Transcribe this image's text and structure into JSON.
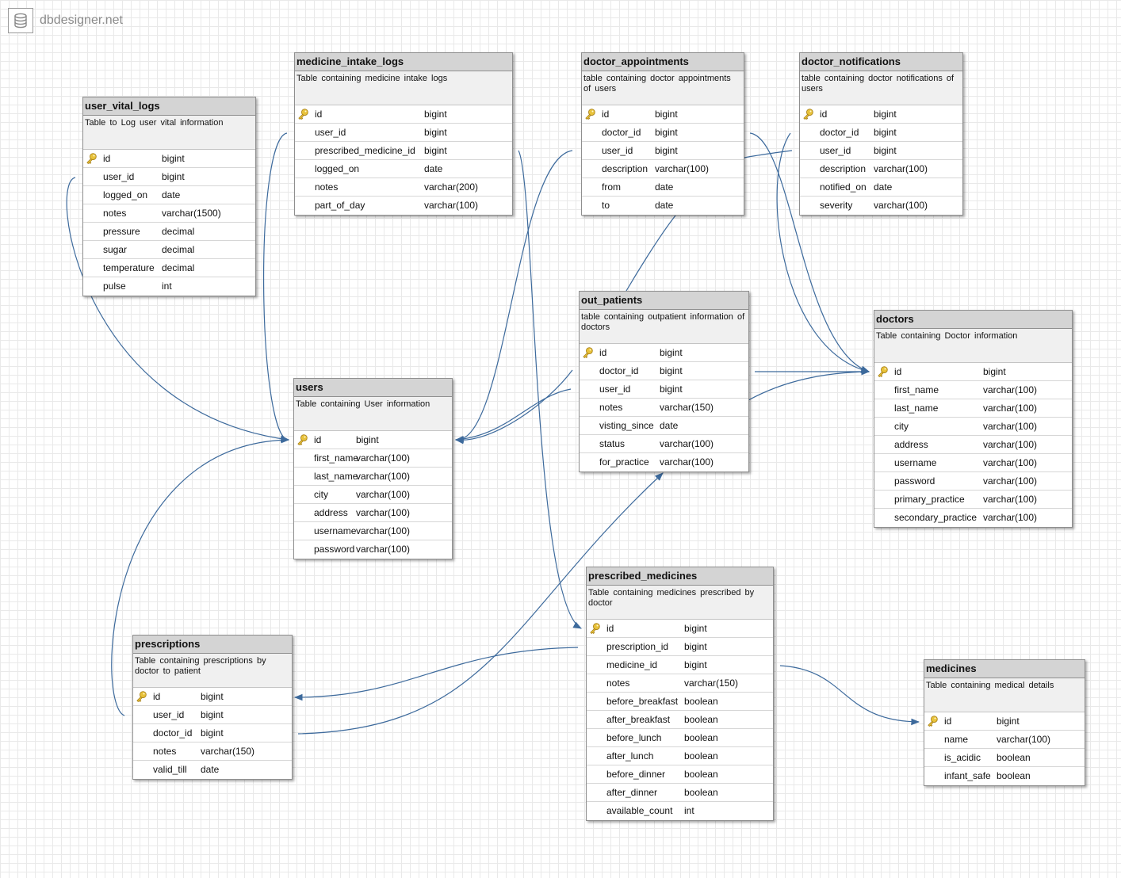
{
  "app": {
    "logo_text": "dbdesigner.net",
    "logo_icon": "database-icon"
  },
  "colors": {
    "connector": "#3d6a9c",
    "header_bg": "#d4d4d4",
    "desc_bg": "#f0f0f0",
    "key_icon": "#e8c23a"
  },
  "tables": [
    {
      "id": "user_vital_logs",
      "name": "user_vital_logs",
      "description": "Table to Log user vital information",
      "columns": [
        {
          "name": "id",
          "type": "bigint",
          "pk": true
        },
        {
          "name": "user_id",
          "type": "bigint"
        },
        {
          "name": "logged_on",
          "type": "date"
        },
        {
          "name": "notes",
          "type": "varchar(1500)"
        },
        {
          "name": "pressure",
          "type": "decimal"
        },
        {
          "name": "sugar",
          "type": "decimal"
        },
        {
          "name": "temperature",
          "type": "decimal"
        },
        {
          "name": "pulse",
          "type": "int"
        }
      ]
    },
    {
      "id": "medicine_intake_logs",
      "name": "medicine_intake_logs",
      "description": "Table containing medicine intake logs",
      "columns": [
        {
          "name": "id",
          "type": "bigint",
          "pk": true
        },
        {
          "name": "user_id",
          "type": "bigint"
        },
        {
          "name": "prescribed_medicine_id",
          "type": "bigint"
        },
        {
          "name": "logged_on",
          "type": "date"
        },
        {
          "name": "notes",
          "type": "varchar(200)"
        },
        {
          "name": "part_of_day",
          "type": "varchar(100)"
        }
      ]
    },
    {
      "id": "doctor_appointments",
      "name": "doctor_appointments",
      "description": "table containing doctor appointments of users",
      "columns": [
        {
          "name": "id",
          "type": "bigint",
          "pk": true
        },
        {
          "name": "doctor_id",
          "type": "bigint"
        },
        {
          "name": "user_id",
          "type": "bigint"
        },
        {
          "name": "description",
          "type": "varchar(100)"
        },
        {
          "name": "from",
          "type": "date"
        },
        {
          "name": "to",
          "type": "date"
        }
      ]
    },
    {
      "id": "doctor_notifications",
      "name": "doctor_notifications",
      "description": "table containing doctor notifications of users",
      "columns": [
        {
          "name": "id",
          "type": "bigint",
          "pk": true
        },
        {
          "name": "doctor_id",
          "type": "bigint"
        },
        {
          "name": "user_id",
          "type": "bigint"
        },
        {
          "name": "description",
          "type": "varchar(100)"
        },
        {
          "name": "notified_on",
          "type": "date"
        },
        {
          "name": "severity",
          "type": "varchar(100)"
        }
      ]
    },
    {
      "id": "out_patients",
      "name": "out_patients",
      "description": "table containing outpatient information of doctors",
      "columns": [
        {
          "name": "id",
          "type": "bigint",
          "pk": true
        },
        {
          "name": "doctor_id",
          "type": "bigint"
        },
        {
          "name": "user_id",
          "type": "bigint"
        },
        {
          "name": "notes",
          "type": "varchar(150)"
        },
        {
          "name": "visting_since",
          "type": "date"
        },
        {
          "name": "status",
          "type": "varchar(100)"
        },
        {
          "name": "for_practice",
          "type": "varchar(100)"
        }
      ]
    },
    {
      "id": "users",
      "name": "users",
      "description": "Table containing User information",
      "columns": [
        {
          "name": "id",
          "type": "bigint",
          "pk": true
        },
        {
          "name": "first_name",
          "type": "varchar(100)"
        },
        {
          "name": "last_name",
          "type": "varchar(100)"
        },
        {
          "name": "city",
          "type": "varchar(100)"
        },
        {
          "name": "address",
          "type": "varchar(100)"
        },
        {
          "name": "username",
          "type": "varchar(100)"
        },
        {
          "name": "password",
          "type": "varchar(100)"
        }
      ]
    },
    {
      "id": "doctors",
      "name": "doctors",
      "description": "Table containing Doctor information",
      "columns": [
        {
          "name": "id",
          "type": "bigint",
          "pk": true
        },
        {
          "name": "first_name",
          "type": "varchar(100)"
        },
        {
          "name": "last_name",
          "type": "varchar(100)"
        },
        {
          "name": "city",
          "type": "varchar(100)"
        },
        {
          "name": "address",
          "type": "varchar(100)"
        },
        {
          "name": "username",
          "type": "varchar(100)"
        },
        {
          "name": "password",
          "type": "varchar(100)"
        },
        {
          "name": "primary_practice",
          "type": "varchar(100)"
        },
        {
          "name": "secondary_practice",
          "type": "varchar(100)"
        }
      ]
    },
    {
      "id": "prescribed_medicines",
      "name": "prescribed_medicines",
      "description": "Table containing medicines prescribed by doctor",
      "columns": [
        {
          "name": "id",
          "type": "bigint",
          "pk": true
        },
        {
          "name": "prescription_id",
          "type": "bigint"
        },
        {
          "name": "medicine_id",
          "type": "bigint"
        },
        {
          "name": "notes",
          "type": "varchar(150)"
        },
        {
          "name": "before_breakfast",
          "type": "boolean"
        },
        {
          "name": "after_breakfast",
          "type": "boolean"
        },
        {
          "name": "before_lunch",
          "type": "boolean"
        },
        {
          "name": "after_lunch",
          "type": "boolean"
        },
        {
          "name": "before_dinner",
          "type": "boolean"
        },
        {
          "name": "after_dinner",
          "type": "boolean"
        },
        {
          "name": "available_count",
          "type": "int"
        }
      ]
    },
    {
      "id": "prescriptions",
      "name": "prescriptions",
      "description": "Table containing prescriptions by doctor to patient",
      "columns": [
        {
          "name": "id",
          "type": "bigint",
          "pk": true
        },
        {
          "name": "user_id",
          "type": "bigint"
        },
        {
          "name": "doctor_id",
          "type": "bigint"
        },
        {
          "name": "notes",
          "type": "varchar(150)"
        },
        {
          "name": "valid_till",
          "type": "date"
        }
      ]
    },
    {
      "id": "medicines",
      "name": "medicines",
      "description": "Table containing medical details",
      "columns": [
        {
          "name": "id",
          "type": "bigint",
          "pk": true
        },
        {
          "name": "name",
          "type": "varchar(100)"
        },
        {
          "name": "is_acidic",
          "type": "boolean"
        },
        {
          "name": "infant_safe",
          "type": "boolean"
        }
      ]
    }
  ],
  "relations": [
    {
      "from": "user_vital_logs.user_id",
      "to": "users.id"
    },
    {
      "from": "medicine_intake_logs.user_id",
      "to": "users.id"
    },
    {
      "from": "medicine_intake_logs.prescribed_medicine_id",
      "to": "prescribed_medicines.id"
    },
    {
      "from": "doctor_appointments.user_id",
      "to": "users.id"
    },
    {
      "from": "doctor_appointments.doctor_id",
      "to": "doctors.id"
    },
    {
      "from": "doctor_notifications.user_id",
      "to": "users.id"
    },
    {
      "from": "doctor_notifications.doctor_id",
      "to": "doctors.id"
    },
    {
      "from": "out_patients.user_id",
      "to": "users.id"
    },
    {
      "from": "out_patients.doctor_id",
      "to": "doctors.id"
    },
    {
      "from": "prescriptions.user_id",
      "to": "users.id"
    },
    {
      "from": "prescriptions.doctor_id",
      "to": "doctors.id"
    },
    {
      "from": "prescribed_medicines.prescription_id",
      "to": "prescriptions.id"
    },
    {
      "from": "prescribed_medicines.medicine_id",
      "to": "medicines.id"
    }
  ]
}
